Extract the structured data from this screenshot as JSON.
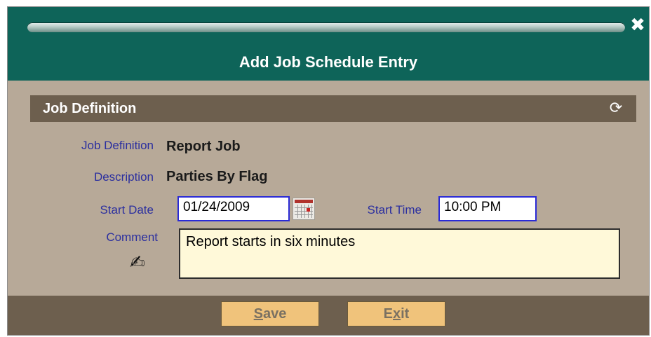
{
  "window": {
    "title": "Add Job Schedule Entry",
    "close_glyph": "✖"
  },
  "section": {
    "title": "Job Definition",
    "refresh_glyph": "⟳"
  },
  "form": {
    "job_definition_label": "Job Definition",
    "job_definition_value": "Report Job",
    "description_label": "Description",
    "description_value": "Parties By Flag",
    "start_date_label": "Start Date",
    "start_date_value": "01/24/2009",
    "start_time_label": "Start Time",
    "start_time_value": "10:00 PM",
    "comment_label": "Comment",
    "comment_value": "Report starts in six minutes"
  },
  "buttons": {
    "save_first": "S",
    "save_rest": "ave",
    "exit_first": "E",
    "exit_mnemonic": "x",
    "exit_rest": "it"
  },
  "icons": {
    "close": "close-icon",
    "refresh": "refresh-icon",
    "calendar": "calendar-icon",
    "edit": "pen-icon"
  },
  "colors": {
    "titlebar": "#0e6459",
    "panel": "#b7a998",
    "section_bar": "#6d5f4e",
    "label": "#2b2f9f",
    "button": "#f0c37b",
    "comment_bg": "#fff9d9"
  }
}
